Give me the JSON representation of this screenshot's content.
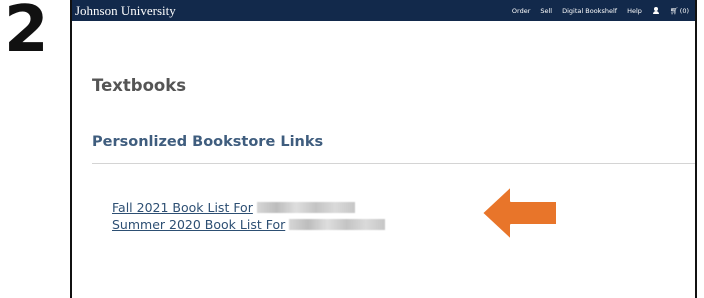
{
  "step": {
    "number": "2"
  },
  "header": {
    "brand": "Johnson University",
    "nav": {
      "order": "Order",
      "sell": "Sell",
      "digital_bookshelf": "Digital Bookshelf",
      "help": "Help",
      "cart_count": "(0)"
    }
  },
  "main": {
    "title": "Textbooks",
    "section_title": "Personlized Bookstore Links",
    "links": [
      {
        "label": "Fall 2021 Book List For"
      },
      {
        "label": "Summer 2020 Book List For"
      }
    ]
  },
  "annotation": {
    "arrow_color": "#e8752a",
    "arrow_direction": "left"
  },
  "colors": {
    "topbar": "#12294b",
    "link": "#2d4f73",
    "section_title": "#3f5d7e",
    "page_title": "#555555"
  },
  "icons": [
    "user-icon",
    "cart-icon",
    "arrow-icon"
  ]
}
